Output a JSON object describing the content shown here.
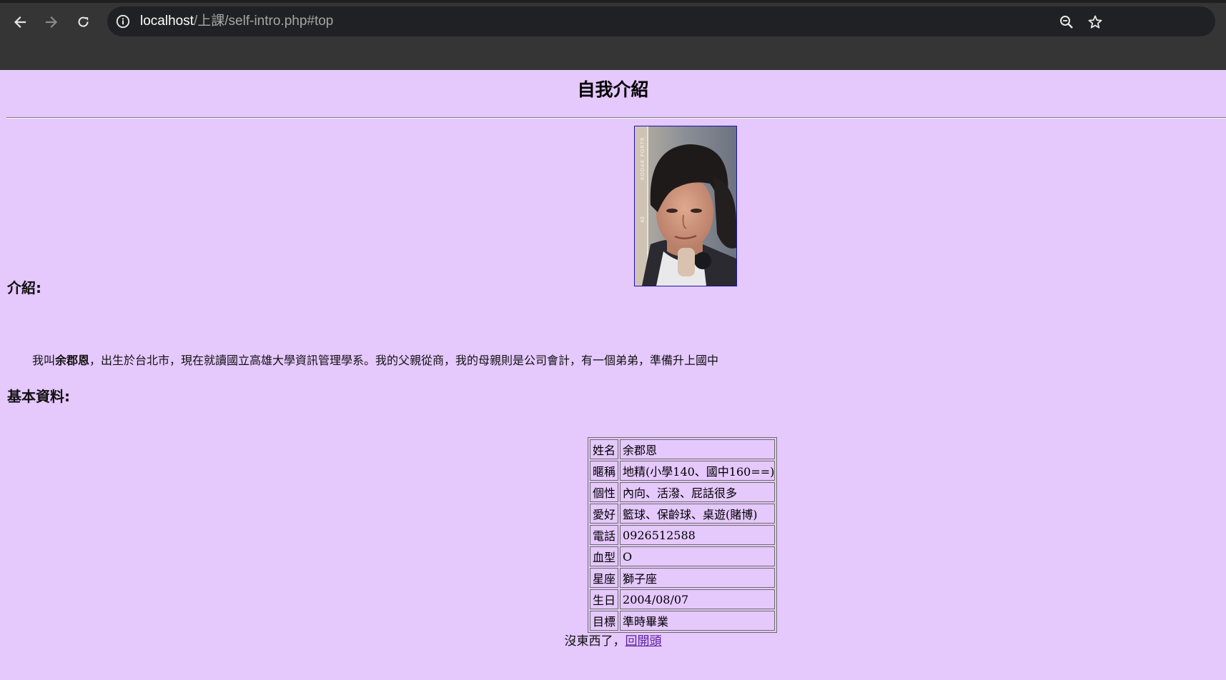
{
  "browser": {
    "url_host": "localhost",
    "url_path": "/上課/self-intro.php#top"
  },
  "page": {
    "title": "自我介紹",
    "photo": {
      "film_label": "KODAK PORTR",
      "frame_number": "43"
    },
    "intro_heading": "介紹:",
    "intro": {
      "prefix": "我叫",
      "name": "余郡恩",
      "suffix": "，出生於台北市，現在就讀國立高雄大學資訊管理學系。我的父親從商，我的母親則是公司會計，有一個弟弟，準備升上國中"
    },
    "basic_heading": "基本資料:",
    "profile": [
      {
        "label": "姓名",
        "value": "余郡恩"
      },
      {
        "label": "暱稱",
        "value": "地精(小學140、國中160==)"
      },
      {
        "label": "個性",
        "value": "內向、活潑、屁話很多"
      },
      {
        "label": "愛好",
        "value": "籃球、保齡球、桌遊(賭博)"
      },
      {
        "label": "電話",
        "value": "0926512588"
      },
      {
        "label": "血型",
        "value": "O"
      },
      {
        "label": "星座",
        "value": "獅子座"
      },
      {
        "label": "生日",
        "value": "2004/08/07"
      },
      {
        "label": "目標",
        "value": "準時畢業"
      }
    ],
    "footer": {
      "text": "沒東西了，",
      "link": "回開頭"
    }
  },
  "colors": {
    "page_background": "#e5c8fc",
    "chrome_background": "#353535",
    "link_visited": "#5b1ea3"
  }
}
